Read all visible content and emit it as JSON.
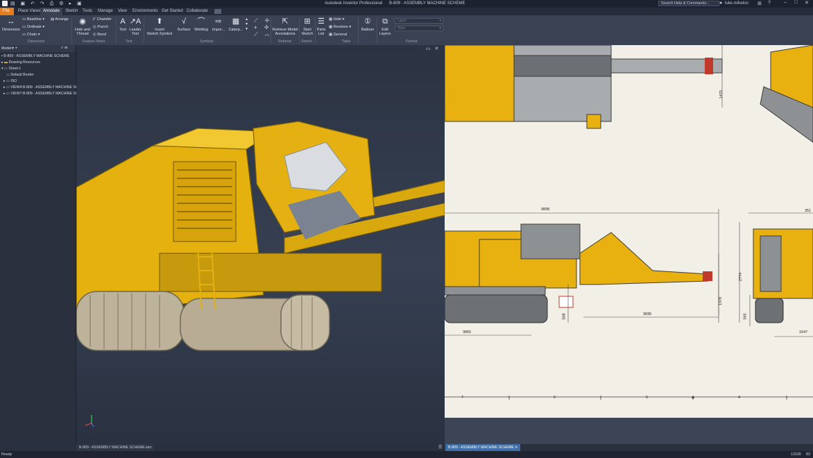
{
  "app": {
    "title": "Autodesk Inventor Professional",
    "document": "B-809 - ASSEMBLY MACHINE SCHEME"
  },
  "search": {
    "placeholder": "Search Help & Commands..."
  },
  "user": {
    "name": "luke.mihelcic"
  },
  "tabs": [
    {
      "label": "File"
    },
    {
      "label": "Place Views"
    },
    {
      "label": "Annotate"
    },
    {
      "label": "Sketch"
    },
    {
      "label": "Tools"
    },
    {
      "label": "Manage"
    },
    {
      "label": "View"
    },
    {
      "label": "Environments"
    },
    {
      "label": "Get Started"
    },
    {
      "label": "Collaborate"
    }
  ],
  "ribbon": {
    "dimension": "Dimension",
    "baseline": "Baseline",
    "ordinate": "Ordinate",
    "chain": "Chain",
    "arrange": "Arrange",
    "hole_thread": [
      "Hole and",
      "Thread"
    ],
    "chamfer": "Chamfer",
    "punch": "Punch",
    "bend": "Bend",
    "text": "Text",
    "leader_text": [
      "Leader",
      "Text"
    ],
    "insert_sketch_symbol": [
      "Insert",
      "Sketch Symbol"
    ],
    "surface": "Surface",
    "welding": "Welding",
    "import": "Impor...",
    "caterpillar": "Caterp...",
    "retrieve": [
      "Retrieve Model",
      "Annotations"
    ],
    "start_sketch": [
      "Start",
      "Sketch"
    ],
    "parts_list": [
      "Parts",
      "List"
    ],
    "hole": "Hole",
    "revision": "Revision",
    "general": "General",
    "balloon": "Balloon",
    "edit_layers": [
      "Edit",
      "Layers"
    ],
    "layer": "Layer",
    "style": "Style",
    "groups": [
      "Dimension",
      "Feature Notes",
      "Text",
      "Symbols",
      "Retrieve",
      "Sketch",
      "Table",
      "Format"
    ]
  },
  "browser": {
    "header": "Model",
    "items": [
      "B-809 - ASSEMBLY MACHINE SCHEME",
      "Drawing Resources",
      "Sheet:1",
      "Default Border",
      "ISO",
      "VIEW4:B-809 - ASSEMBLY MACHINE SC",
      "VIEW7:B-809 - ASSEMBLY MACHINE SC"
    ]
  },
  "doc_tabs": {
    "left": "B-809 - ASSEMBLY MACHINE SCHEME.iam",
    "right": "B-809 - ASSEMBLY MACHINE SCHEME"
  },
  "dimensions": {
    "d1475": "1475",
    "d9898": "9898",
    "d351": "351",
    "d508": "508",
    "d3695": "3695",
    "d1378": "1378",
    "d3865": "3865",
    "d2774": "2774",
    "d565": "565",
    "d1547": "1547"
  },
  "ruler": [
    "7",
    "6",
    "5",
    "4"
  ],
  "status": {
    "left": "Ready",
    "right1": "13100",
    "right2": "83"
  },
  "colors": {
    "accent": "#e87b1a",
    "machine": "#e8b312",
    "drawing_bg": "#f2f0e6"
  }
}
